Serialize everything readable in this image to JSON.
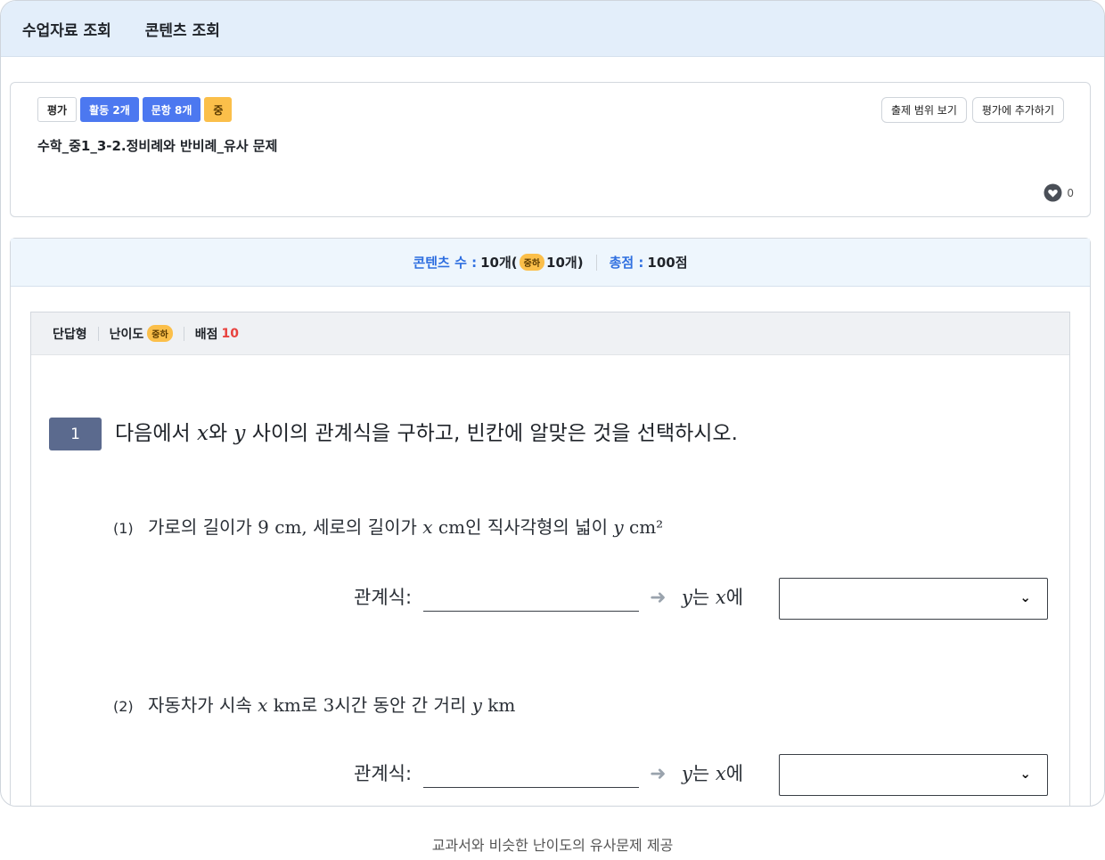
{
  "nav": {
    "tabs": [
      "수업자료 조회",
      "콘텐츠 조회"
    ]
  },
  "card": {
    "tags": {
      "eval": "평가",
      "activities": "활동 2개",
      "items": "문항 8개",
      "level": "중"
    },
    "title": "수학_중1_3-2.정비례와 반비례_유사 문제",
    "buttons": {
      "range": "출제 범위 보기",
      "add": "평가에 추가하기"
    },
    "likes": "0"
  },
  "summary": {
    "contents_label": "콘텐츠 수 :",
    "contents_value": "10개(",
    "difficulty_pill": "중하",
    "contents_value2": "10개)",
    "score_label": "총점 :",
    "score_value": "100점"
  },
  "question": {
    "type": "단답형",
    "difficulty_label": "난이도",
    "difficulty_pill": "중하",
    "points_label": "배점",
    "points_value": "10",
    "number": "1",
    "text_pre": "다음에서",
    "var_x": "x",
    "text_mid": "와",
    "var_y": "y",
    "text_post": "사이의 관계식을 구하고, 빈칸에 알맞은 것을 선택하시오.",
    "subs": [
      {
        "no": "(1)",
        "t1": "가로의 길이가",
        "m1": "9 cm,",
        "t2": "세로의 길이가",
        "m2": "x",
        "m2u": "cm",
        "t3": "인 직사각형의 넓이",
        "m3": "y",
        "m3u": "cm²"
      },
      {
        "no": "(2)",
        "t1": "자동차가 시속",
        "m1": "x",
        "m1u": "km",
        "t2": "로",
        "m2": "3",
        "t3": "시간 동안 간 거리",
        "m3": "y",
        "m3u": "km"
      }
    ],
    "relation_label": "관계식:",
    "hint_y": "y",
    "hint_mid": "는",
    "hint_x": "x",
    "hint_end": "에"
  },
  "caption": "교과서와 비슷한 난이도의 유사문제 제공",
  "colors": {
    "accent": "#4c78f0",
    "level": "#fbbf4a",
    "nav_bg": "#e3eefa",
    "score": "#e8423e"
  }
}
